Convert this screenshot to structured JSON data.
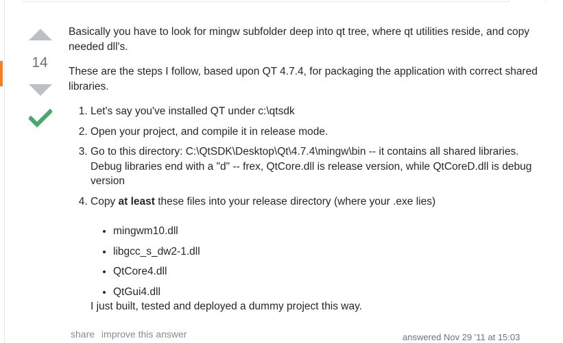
{
  "vote": {
    "count": "14"
  },
  "answer": {
    "paragraph1": "Basically you have to look for mingw subfolder deep into qt tree, where qt utilities reside, and copy needed dll's.",
    "paragraph2": "These are the steps I follow, based upon QT 4.7.4, for packaging the application with correct shared libraries.",
    "steps": [
      "Let's say you've installed QT under c:\\qtsdk",
      "Open your project, and compile it in release mode.",
      "Go to this directory: C:\\QtSDK\\Desktop\\Qt\\4.7.4\\mingw\\bin -- it contains all shared libraries. Debug libraries end with a \"d\" -- frex, QtCore.dll is release version, while QtCoreD.dll is debug version"
    ],
    "step4": {
      "prefix": "Copy ",
      "bold": "at least",
      "suffix": " these files into your release directory (where your .exe lies)"
    },
    "files": [
      "mingwm10.dll",
      "libgcc_s_dw2-1.dll",
      "QtCore4.dll",
      "QtGui4.dll"
    ],
    "tail": "I just built, tested and deployed a dummy project this way."
  },
  "menu": {
    "share": "share",
    "improve": "improve this answer"
  },
  "answered": "answered Nov 29 '11 at 15:03",
  "colors": {
    "accent": "#f48024",
    "accepted": "#48a868",
    "vote_arrow": "#bbc0c4"
  },
  "icons": [
    "vote-up-icon",
    "vote-down-icon",
    "accepted-check-icon"
  ]
}
